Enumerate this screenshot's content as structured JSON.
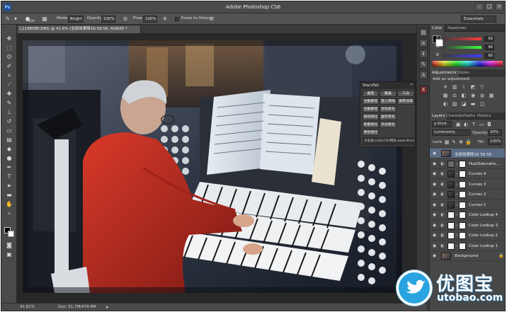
{
  "window": {
    "title": "Adobe Photoshop CS6",
    "logo": "Ps",
    "minimize": "–",
    "maximize": "□",
    "close": "×"
  },
  "options_bar": {
    "mode_label": "Mode:",
    "mode_value": "Bright",
    "opacity_label": "Opacity:",
    "opacity_value": "100%",
    "flow_label": "Flow:",
    "flow_value": "100%",
    "erase_history_label": "Erase to History",
    "workspace": "Essentials",
    "brush_size": "100"
  },
  "document": {
    "tab_label": "L1198080.DNG @ 41.6% (全部效果降16:58:56, RGB/8) *"
  },
  "status": {
    "zoom": "41.61%",
    "doc_size": "Doc: 51.7M/479.4M"
  },
  "plugin": {
    "title": "StarsTail",
    "close": "»",
    "buttons": [
      [
        "画笔",
        "覆盖",
        "工具"
      ],
      [
        "全都都拓",
        "暨入降噪",
        "减表涂抹"
      ],
      [
        "全都都拓",
        "全局柔化"
      ],
      [
        "输出锐化",
        "画布单化"
      ],
      [
        "新都锐化",
        "多风柔化"
      ],
      [
        "降低锐化"
      ]
    ],
    "footer": "点击进入StarsTail网站 www.StarsTail.com"
  },
  "panels": {
    "color_tabs": [
      "Color",
      "Swatches"
    ],
    "color": {
      "rows": [
        {
          "letter": "R",
          "value": "60"
        },
        {
          "letter": "G",
          "value": "60"
        },
        {
          "letter": "B",
          "value": "60"
        }
      ]
    },
    "adjustment_tabs": [
      "Adjustments",
      "Styles"
    ],
    "add_adjustment": "Add an adjustment",
    "layer_tabs": [
      "Layers",
      "Channels",
      "Paths",
      "History"
    ],
    "kind_filter": "ρ Kind",
    "blend_mode": "Luminosity",
    "opacity_label": "Opacity:",
    "opacity_value": "30%",
    "lock_label": "Lock:",
    "fill_label": "Fill:",
    "fill_value": "100%",
    "layers": [
      {
        "name": "全部效果降16 58 56",
        "selected": true,
        "thumb": "photo"
      },
      {
        "name": "Hue/Saturatio...",
        "thumb": "adj"
      },
      {
        "name": "Curves 4",
        "thumb": "dark"
      },
      {
        "name": "Curves 3",
        "thumb": "dark"
      },
      {
        "name": "Curves 2",
        "thumb": "dark"
      },
      {
        "name": "Curves 1",
        "thumb": "dark"
      },
      {
        "name": "Color Lookup 4",
        "thumb": "white"
      },
      {
        "name": "Color Lookup 3",
        "thumb": "white"
      },
      {
        "name": "Color Lookup 2",
        "thumb": "white"
      },
      {
        "name": "Color Lookup 1",
        "thumb": "white"
      },
      {
        "name": "Background",
        "thumb": "photo",
        "background": true
      }
    ]
  },
  "watermark": {
    "text": "优图宝",
    "url": "utobao.com"
  },
  "colors": {
    "chrome": "#3c3c3c",
    "selected_layer": "#5a6c86",
    "close_x": "#6a2a2a",
    "watermark_blue": "#2aa4e0"
  }
}
